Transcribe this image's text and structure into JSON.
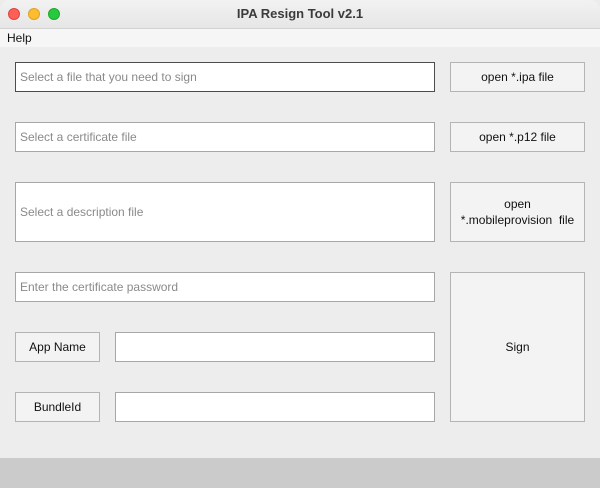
{
  "window": {
    "title": "IPA Resign Tool v2.1"
  },
  "menu": {
    "help": "Help"
  },
  "fields": {
    "ipa_placeholder": "Select a file that you need to sign",
    "cert_placeholder": "Select a certificate file",
    "desc_placeholder": "Select a description file",
    "password_placeholder": "Enter the certificate password",
    "app_name_value": "",
    "bundle_id_value": ""
  },
  "buttons": {
    "open_ipa": "open *.ipa file",
    "open_p12": "open *.p12 file",
    "open_mobileprovision_line1": "open",
    "open_mobileprovision_line2": "*.mobileprovision  file",
    "app_name": "App Name",
    "bundle_id": "BundleId",
    "sign": "Sign"
  }
}
